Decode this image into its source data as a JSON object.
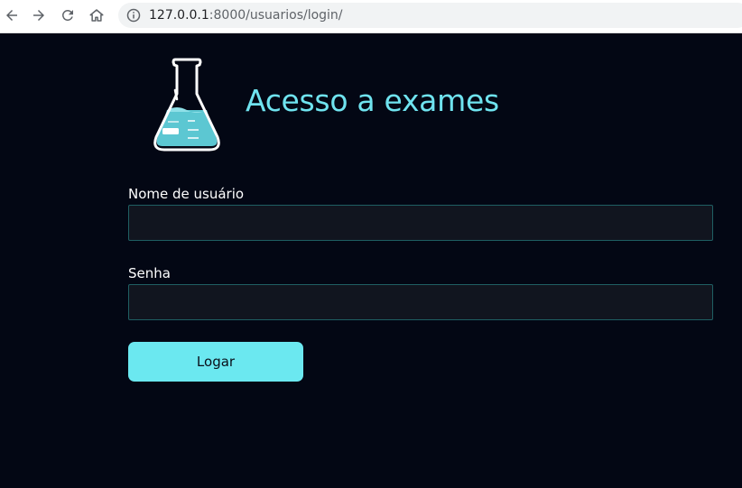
{
  "browser": {
    "back_icon": "arrow-left-icon",
    "forward_icon": "arrow-right-icon",
    "reload_icon": "reload-icon",
    "home_icon": "home-icon",
    "info_icon": "info-icon",
    "url_host": "127.0.0.1",
    "url_rest": ":8000/usuarios/login/"
  },
  "page": {
    "logo_icon": "flask-icon",
    "title": "Acesso a exames"
  },
  "form": {
    "username_label": "Nome de usuário",
    "username_value": "",
    "password_label": "Senha",
    "password_value": "",
    "submit_label": "Logar"
  },
  "colors": {
    "background": "#030714",
    "accent": "#6be8f0",
    "field_background": "#11151f",
    "field_border": "#1f5f63"
  }
}
